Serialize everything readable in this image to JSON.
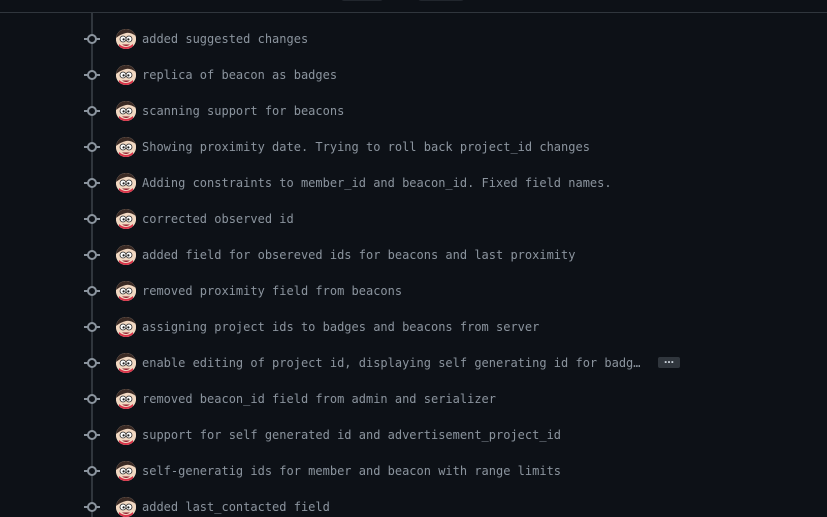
{
  "commits": [
    {
      "message": "added suggested changes",
      "avatar": "avatar-icon"
    },
    {
      "message": "replica of beacon as badges",
      "avatar": "avatar-icon"
    },
    {
      "message": "scanning support for beacons",
      "avatar": "avatar-icon"
    },
    {
      "message": "Showing proximity date. Trying to roll back project_id changes",
      "avatar": "avatar-icon"
    },
    {
      "message": "Adding constraints to member_id and beacon_id. Fixed field names.",
      "avatar": "avatar-icon"
    },
    {
      "message": "corrected observed id",
      "avatar": "avatar-icon"
    },
    {
      "message": "added field for obsereved ids for beacons and last proximity",
      "avatar": "avatar-icon"
    },
    {
      "message": "removed proximity field from beacons",
      "avatar": "avatar-icon"
    },
    {
      "message": "assigning project ids to badges and beacons from server",
      "avatar": "avatar-icon"
    },
    {
      "message": "enable editing of project id, displaying self generating id for badge…",
      "avatar": "avatar-icon",
      "expand_label": "…"
    },
    {
      "message": "removed beacon_id field from admin and serializer",
      "avatar": "avatar-icon"
    },
    {
      "message": "support for self generated id and advertisement_project_id",
      "avatar": "avatar-icon"
    },
    {
      "message": "self-generatig ids for member and beacon with range limits",
      "avatar": "avatar-icon"
    },
    {
      "message": "added last_contacted field",
      "avatar": "avatar-icon"
    }
  ],
  "colors": {
    "background": "#0d1117",
    "timeline": "#30363d",
    "text": "#8b949e"
  }
}
